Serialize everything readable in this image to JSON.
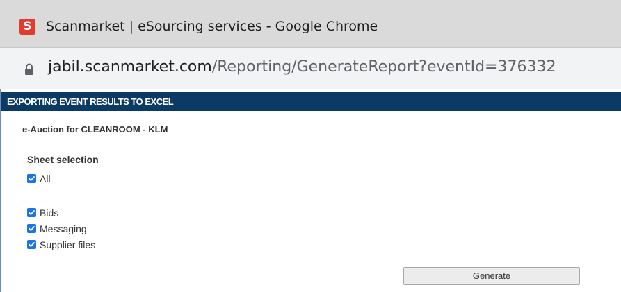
{
  "window": {
    "app_icon_letter": "S",
    "title": "Scanmarket | eSourcing services - Google Chrome"
  },
  "address_bar": {
    "url_host": "jabil.scanmarket.com",
    "url_path": "/Reporting/GenerateReport?eventId=376332",
    "lock_icon": "lock-icon"
  },
  "page": {
    "header": "EXPORTING EVENT RESULTS TO EXCEL",
    "event_name": "e-Auction for CLEANROOM - KLM",
    "sheet_selection_label": "Sheet selection",
    "all_option": {
      "label": "All",
      "checked": true
    },
    "sheets": [
      {
        "label": "Bids",
        "checked": true
      },
      {
        "label": "Messaging",
        "checked": true
      },
      {
        "label": "Supplier files",
        "checked": true
      }
    ],
    "generate_label": "Generate"
  },
  "colors": {
    "header_band": "#0b3a64",
    "checkbox": "#1a73e8",
    "app_icon": "#e13b2f"
  }
}
